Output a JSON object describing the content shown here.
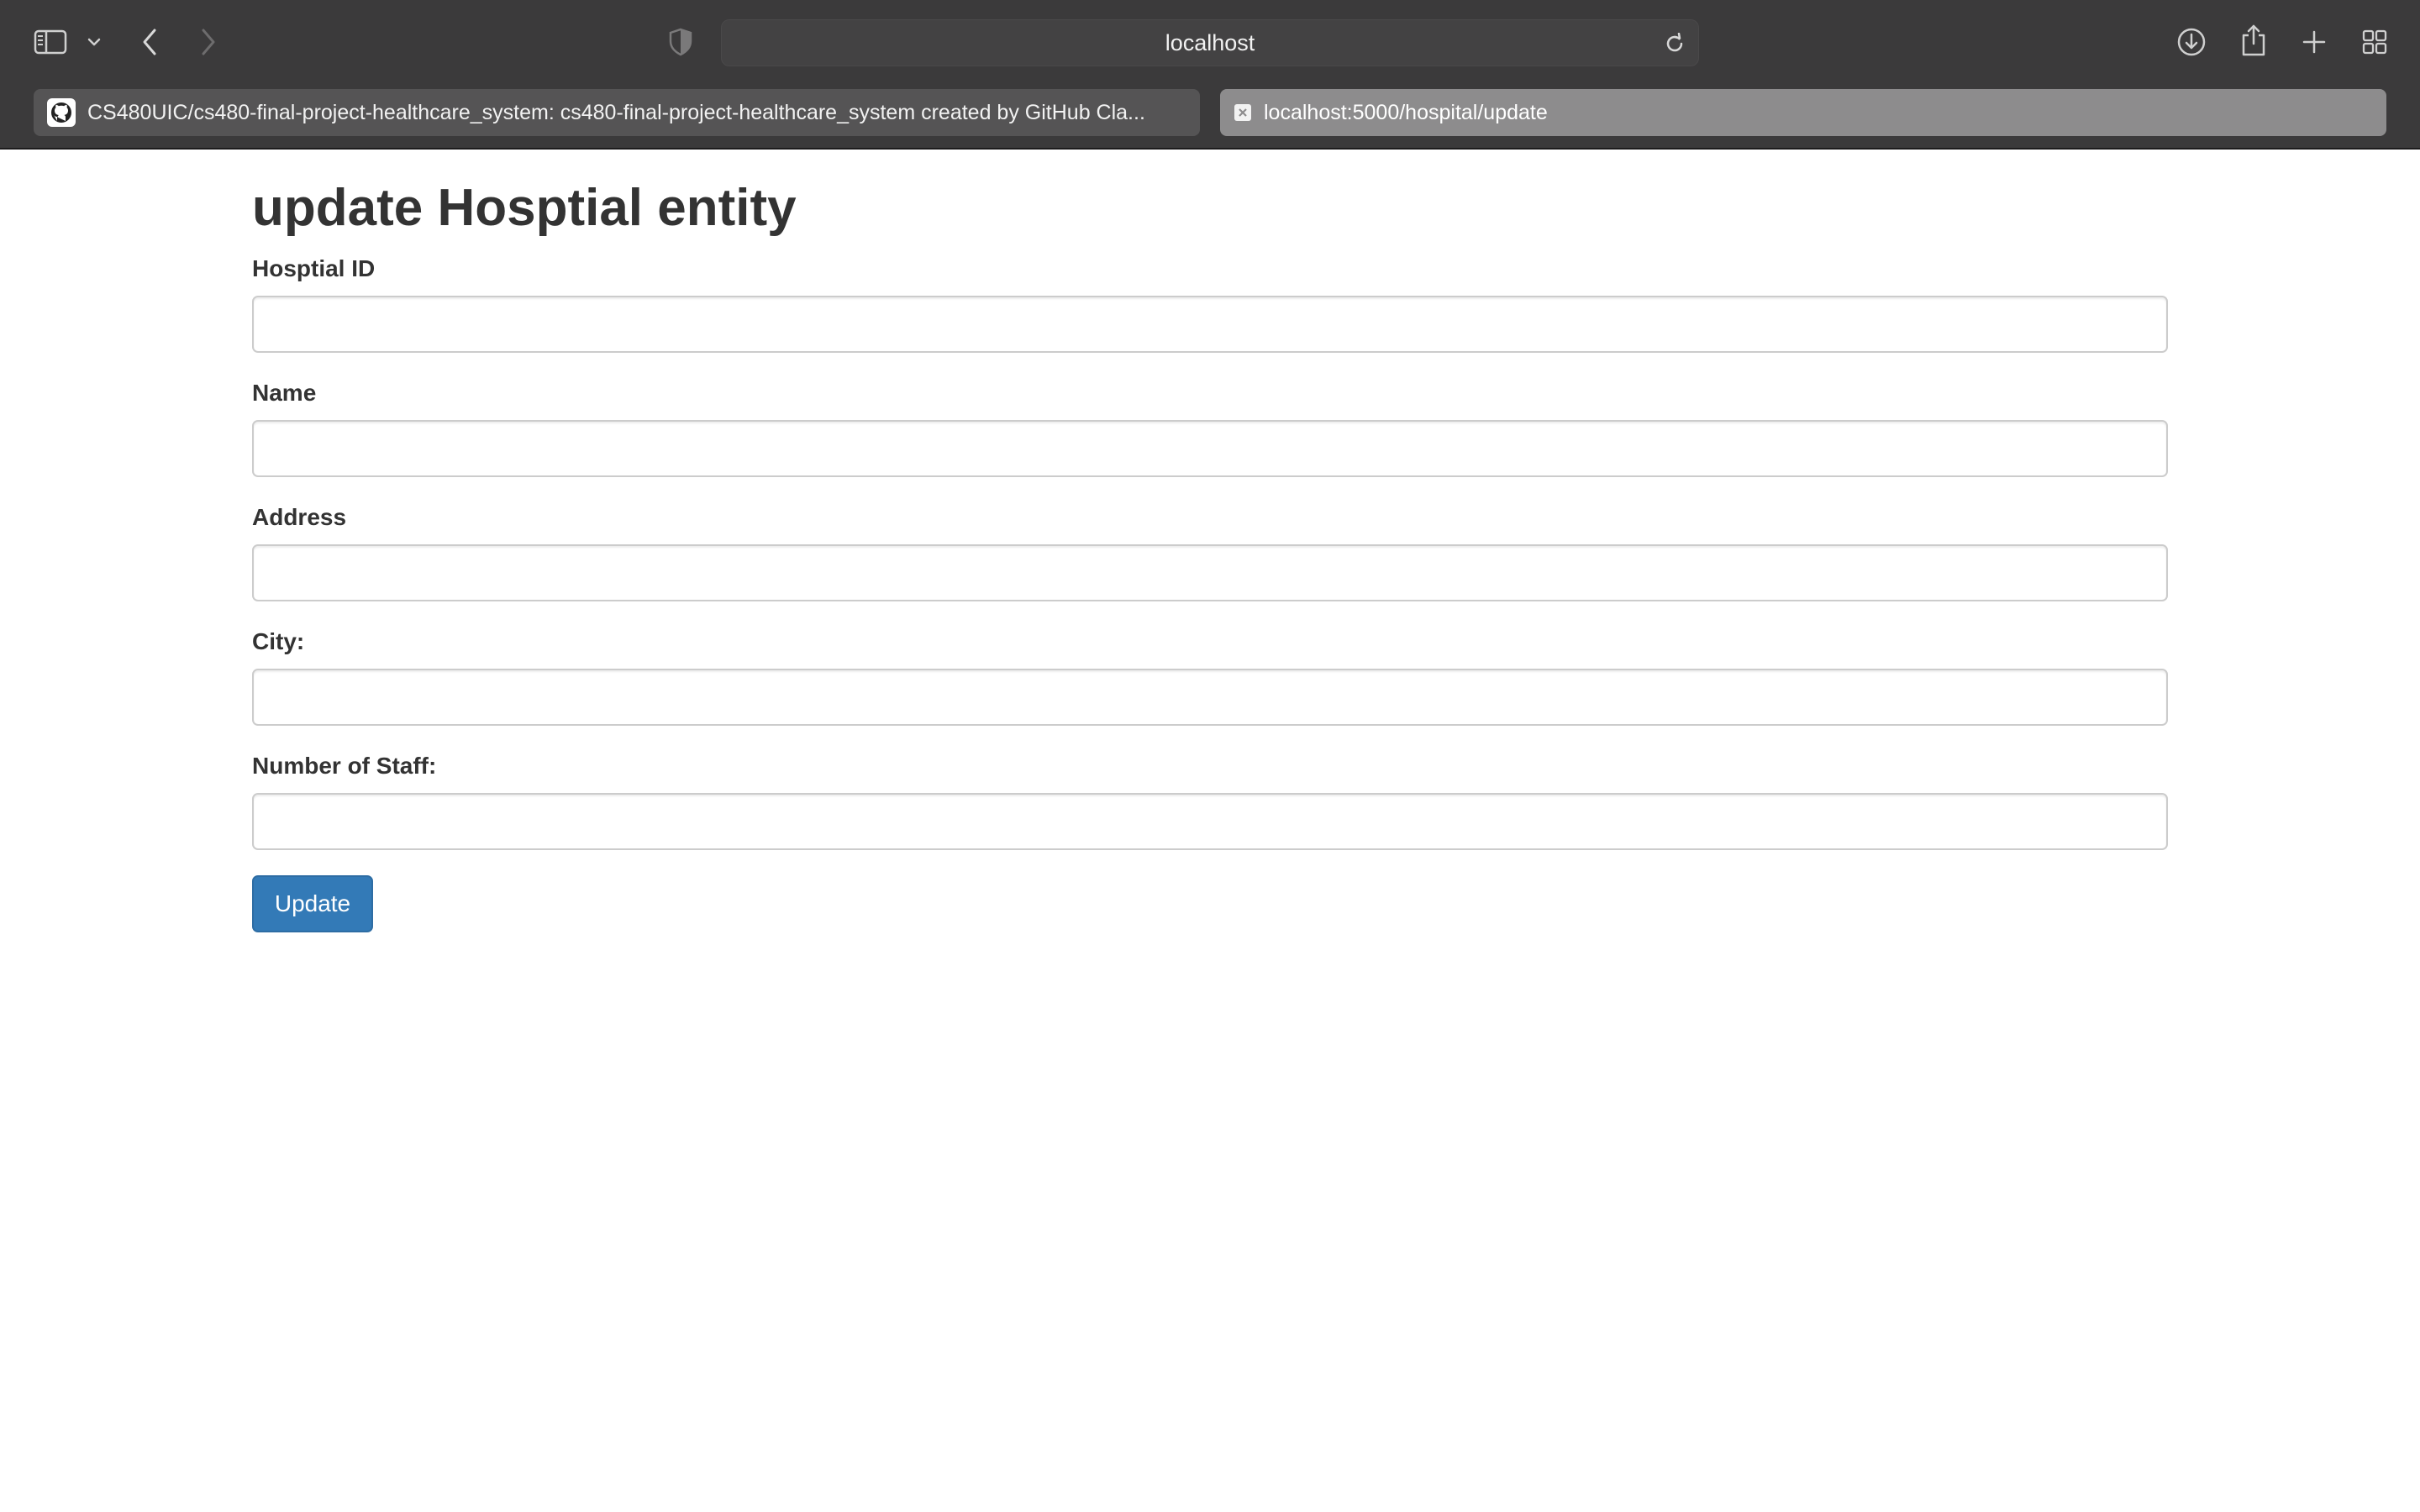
{
  "browser": {
    "address_text": "localhost",
    "icons": {
      "sidebar": "sidebar-icon",
      "sidebar_menu": "chevron-down-icon",
      "back": "back-arrow-icon",
      "forward": "forward-arrow-icon",
      "privacy": "shield-icon",
      "reload": "reload-icon",
      "downloads": "download-icon",
      "share": "share-icon",
      "new_tab": "plus-icon",
      "tab_overview": "grid-icon"
    },
    "tabs": [
      {
        "title": "CS480UIC/cs480-final-project-healthcare_system: cs480-final-project-healthcare_system created by GitHub Cla...",
        "icon": "github-icon",
        "active": false
      },
      {
        "title": "localhost:5000/hospital/update",
        "icon": "blank-page-icon",
        "active": true
      }
    ]
  },
  "form": {
    "heading": "update Hosptial entity",
    "fields": [
      {
        "label": "Hosptial ID",
        "value": "",
        "placeholder": ""
      },
      {
        "label": "Name",
        "value": "",
        "placeholder": ""
      },
      {
        "label": "Address",
        "value": "",
        "placeholder": ""
      },
      {
        "label": "City:",
        "value": "",
        "placeholder": ""
      },
      {
        "label": "Number of Staff:",
        "value": "",
        "placeholder": ""
      }
    ],
    "submit_label": "Update"
  },
  "colors": {
    "chrome_background": "#3b3a3b",
    "active_tab": "#8d8c8d",
    "inactive_tab": "#555455",
    "primary_button": "#337ab7",
    "text": "#333333",
    "input_border": "#cccccc"
  }
}
